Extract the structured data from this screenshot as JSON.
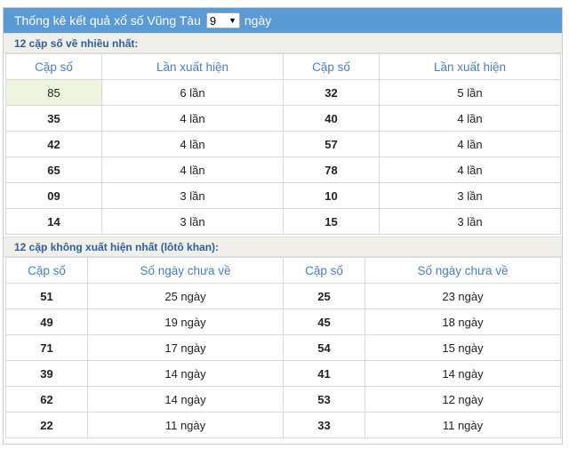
{
  "header": {
    "title_prefix": "Thống kê kết quả xổ số Vũng Tàu",
    "days_value": "9",
    "title_suffix": "ngày"
  },
  "section1": {
    "title": "12 cặp số về nhiều nhất:",
    "col1": "Cặp số",
    "col2": "Lần xuất hiện",
    "col3": "Cặp số",
    "col4": "Lần xuất hiện",
    "rows": [
      {
        "a": "85",
        "ac": "6 lần",
        "b": "32",
        "bc": "5 lần"
      },
      {
        "a": "35",
        "ac": "4 lần",
        "b": "40",
        "bc": "4 lần"
      },
      {
        "a": "42",
        "ac": "4 lần",
        "b": "57",
        "bc": "4 lần"
      },
      {
        "a": "65",
        "ac": "4 lần",
        "b": "78",
        "bc": "4 lần"
      },
      {
        "a": "09",
        "ac": "3 lần",
        "b": "10",
        "bc": "3 lần"
      },
      {
        "a": "14",
        "ac": "3 lần",
        "b": "15",
        "bc": "3 lần"
      }
    ]
  },
  "section2": {
    "title": "12 cặp không xuất hiện nhất (lôtô khan):",
    "col1": "Cặp số",
    "col2": "Số ngày chưa về",
    "col3": "Cặp số",
    "col4": "Số ngày chưa về",
    "rows": [
      {
        "a": "51",
        "ac": "25 ngày",
        "b": "25",
        "bc": "23 ngày"
      },
      {
        "a": "49",
        "ac": "19 ngày",
        "b": "45",
        "bc": "18 ngày"
      },
      {
        "a": "71",
        "ac": "17 ngày",
        "b": "54",
        "bc": "15 ngày"
      },
      {
        "a": "39",
        "ac": "14 ngày",
        "b": "41",
        "bc": "14 ngày"
      },
      {
        "a": "62",
        "ac": "14 ngày",
        "b": "53",
        "bc": "12 ngày"
      },
      {
        "a": "22",
        "ac": "11 ngày",
        "b": "33",
        "bc": "11 ngày"
      }
    ]
  }
}
